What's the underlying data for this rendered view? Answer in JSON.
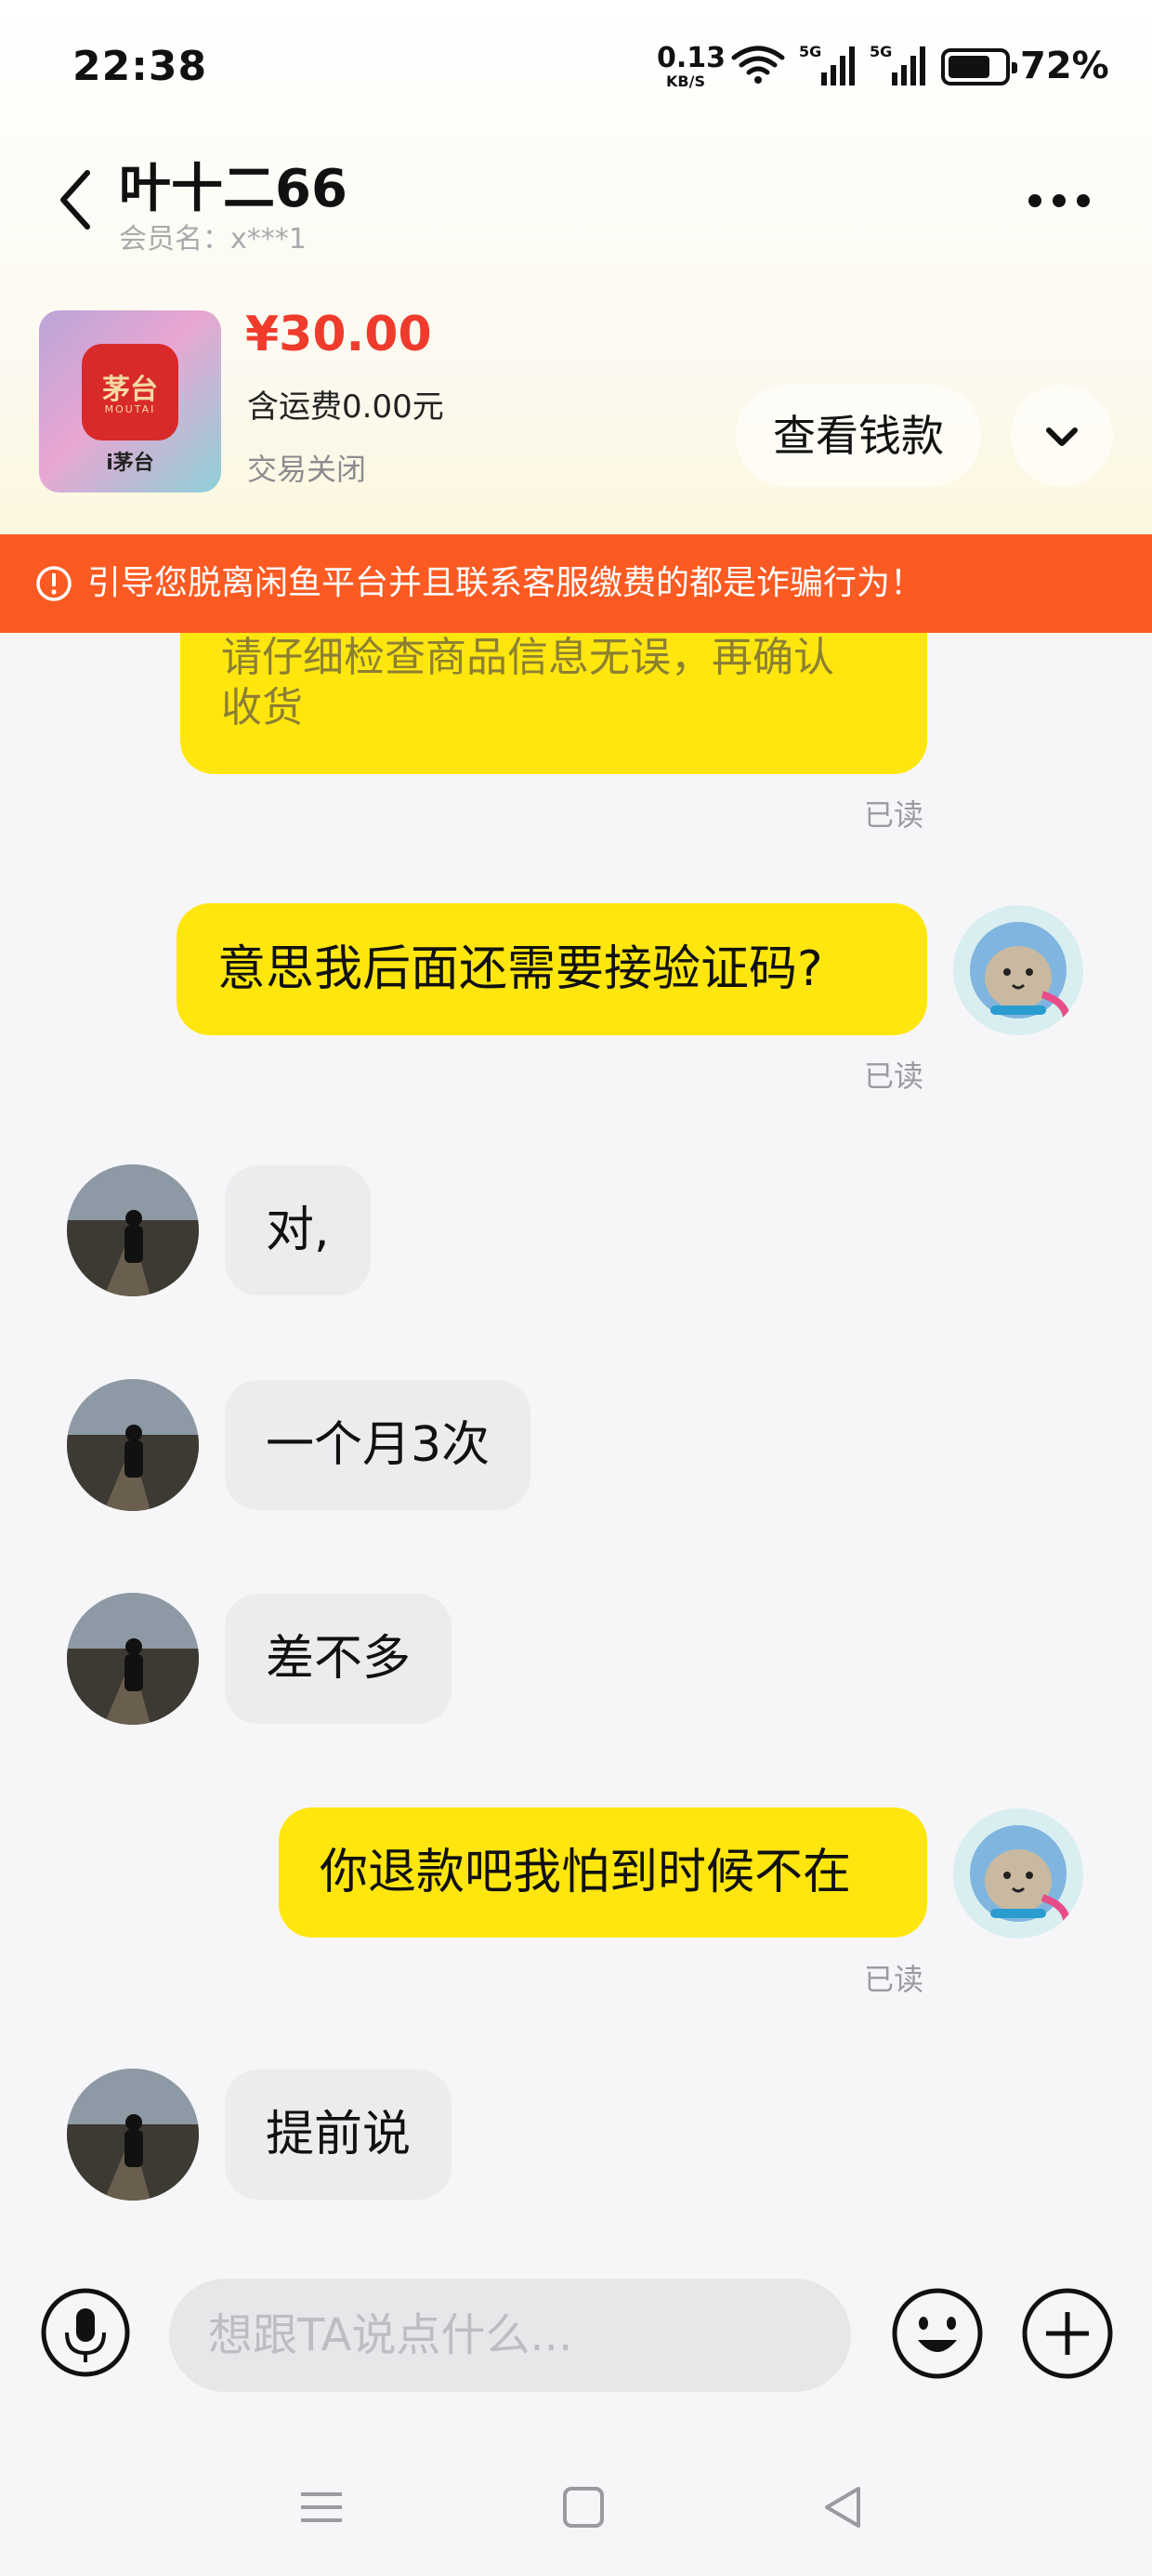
{
  "status_bar": {
    "time": "22:38",
    "net_speed": "0.13",
    "net_unit": "KB/S",
    "sim1": "5G",
    "sim2": "5G",
    "battery": "72%"
  },
  "header": {
    "title": "叶十二66",
    "subtitle": "会员名：x***1"
  },
  "product": {
    "thumb_logo": "茅台",
    "thumb_brand": "MOUTAI",
    "thumb_caption": "i茅台",
    "price": "¥30.00",
    "shipping": "含运费0.00元",
    "state": "交易关闭",
    "refund_button": "查看钱款"
  },
  "warning": {
    "text": "引导您脱离闲鱼平台并且联系客服缴费的都是诈骗行为！"
  },
  "messages": {
    "m0": {
      "text_line1": "请仔细检查商品信息无误，再确认",
      "text_line2": "收货",
      "status": "已读"
    },
    "m1": {
      "text": "意思我后面还需要接验证码?",
      "status": "已读"
    },
    "m2": {
      "text": "对,"
    },
    "m3": {
      "text": "一个月3次"
    },
    "m4": {
      "text": "差不多"
    },
    "m5": {
      "text": "你退款吧我怕到时候不在",
      "status": "已读"
    },
    "m6": {
      "text": "提前说"
    }
  },
  "input": {
    "placeholder": "想跟TA说点什么..."
  },
  "colors": {
    "accent_yellow": "#ffe60f",
    "warning_orange": "#fb5a22",
    "price_red": "#ef3b2c"
  }
}
